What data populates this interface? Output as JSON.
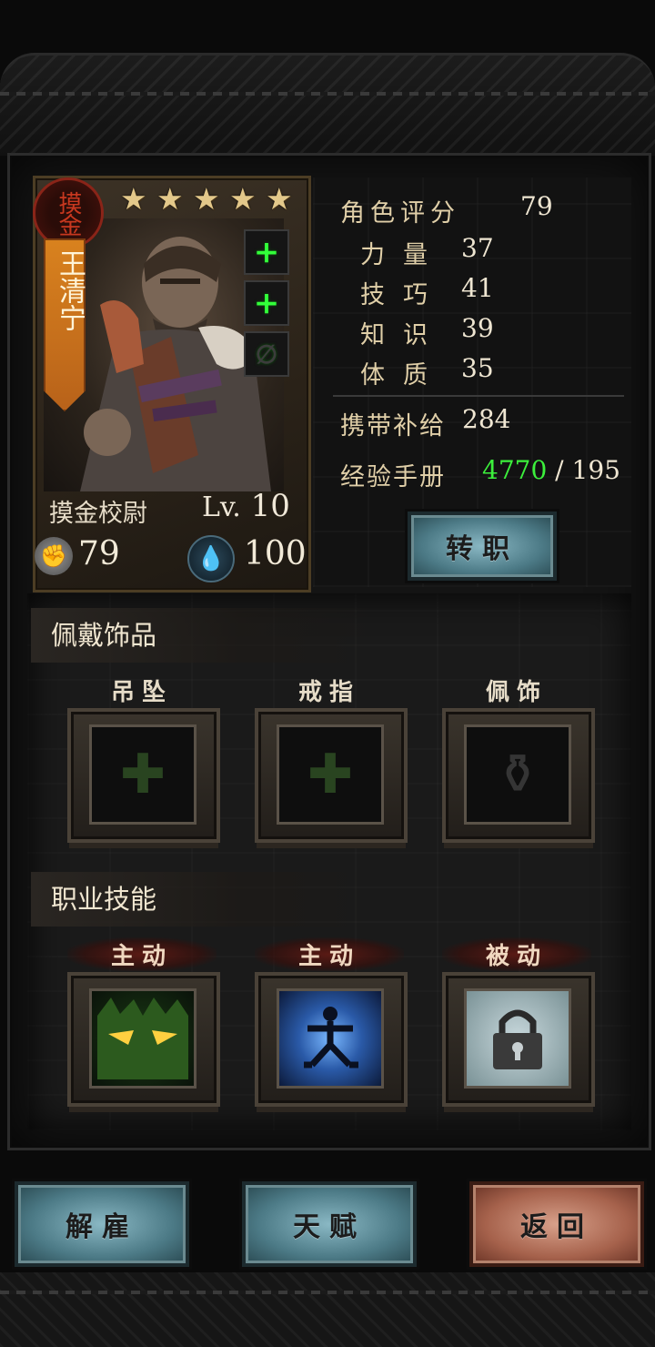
{
  "hero": {
    "class_seal": "摸金",
    "name": "王清宁",
    "stars": [
      "★",
      "★",
      "★",
      "★",
      "★"
    ],
    "class_name": "摸金校尉",
    "level_prefix": "Lv.",
    "level": "10",
    "power": "79",
    "stamina": "100",
    "side_slots": [
      "+",
      "+",
      ""
    ]
  },
  "stats": {
    "rating_label": "角色评分",
    "rating": "79",
    "str_label": "力量",
    "str": "37",
    "skill_label": "技巧",
    "skill": "41",
    "know_label": "知识",
    "know": "39",
    "con_label": "体质",
    "con": "35",
    "supply_label": "携带补给",
    "supply": "284",
    "exp_label": "经验手册",
    "exp_current": "4770",
    "exp_sep": " / ",
    "exp_required": "195",
    "promote_button": "转职"
  },
  "accessories": {
    "title": "佩戴饰品",
    "slots": [
      {
        "label": "吊坠",
        "icon": "pendant-icon"
      },
      {
        "label": "戒指",
        "icon": "ring-icon"
      },
      {
        "label": "佩饰",
        "icon": "charm-icon"
      }
    ]
  },
  "skills": {
    "title": "职业技能",
    "slots": [
      {
        "label": "主动",
        "icon": "glowing-eyes-icon"
      },
      {
        "label": "主动",
        "icon": "martial-stance-icon"
      },
      {
        "label": "被动",
        "icon": "lock-icon"
      }
    ]
  },
  "footer": {
    "dismiss": "解雇",
    "talent": "天赋",
    "back": "返回"
  },
  "colors": {
    "exp_green": "#3cf03c",
    "plus_green": "#32ff3a",
    "name_banner": "#d9821e",
    "button_blue": "#4c7a86",
    "button_red": "#a6624c"
  }
}
